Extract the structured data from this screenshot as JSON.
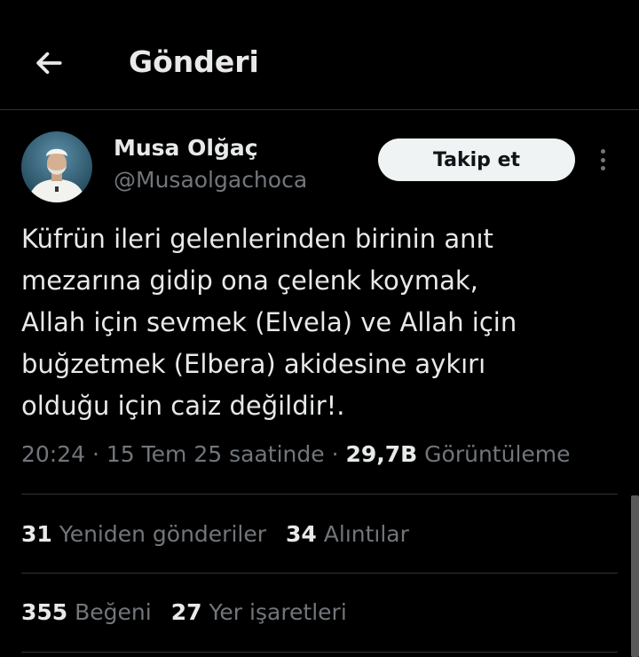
{
  "header": {
    "title": "Gönderi",
    "back_icon": "arrow-left-icon"
  },
  "author": {
    "name": "Musa Olğaç",
    "handle": "@Musaolgachoca",
    "follow_label": "Takip et",
    "more_icon": "more-vertical-icon"
  },
  "tweet": {
    "text": "Küfrün ileri gelenlerinden birinin anıt\nmezarına gidip ona çelenk koymak,\nAllah için sevmek (Elvela) ve Allah için\nbuğzetmek (Elbera) akidesine aykırı\nolduğu için caiz değildir!.",
    "time": "20:24",
    "sep1": " · ",
    "date": "15 Tem 25 saatinde",
    "sep2": " · ",
    "views_count": "29,7B",
    "views_label": "Görüntüleme"
  },
  "stats": {
    "retweets_count": "31",
    "retweets_label": "Yeniden gönderiler",
    "quotes_count": "34",
    "quotes_label": "Alıntılar",
    "likes_count": "355",
    "likes_label": "Beğeni",
    "bookmarks_count": "27",
    "bookmarks_label": "Yer işaretleri"
  },
  "colors": {
    "background": "#000000",
    "primary_text": "#e7e9ea",
    "secondary_text": "#71767b",
    "divider": "#2f3336",
    "follow_button_bg": "#eff3f4"
  }
}
